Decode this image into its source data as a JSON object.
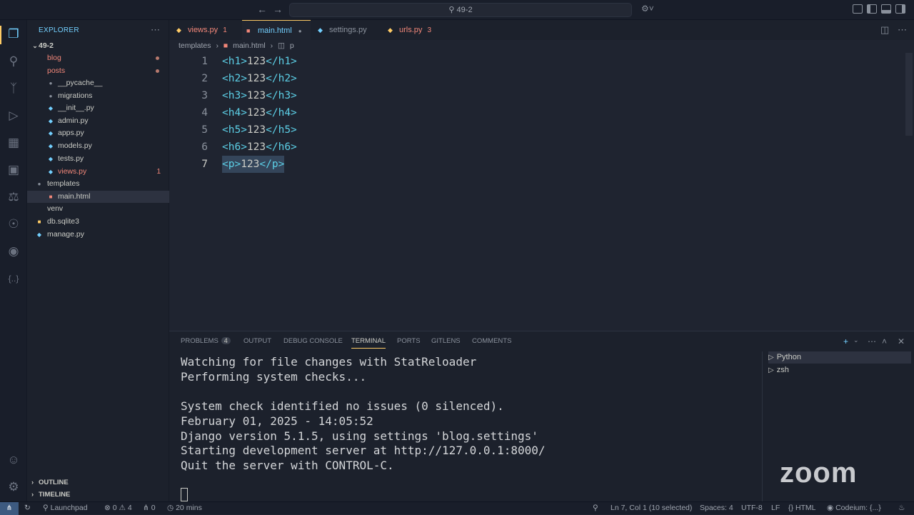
{
  "window": {
    "title": "49-2"
  },
  "colors": {
    "accent": "#ffcc66",
    "link": "#73d0ff",
    "tag": "#5ccfe6",
    "error": "#f28779"
  },
  "explorer": {
    "title": "EXPLORER",
    "more_icon": "ellipsis-icon",
    "root": "49-2",
    "items": [
      {
        "label": "blog",
        "kind": "folder",
        "depth": 1,
        "status": "dot"
      },
      {
        "label": "posts",
        "kind": "folder",
        "depth": 1,
        "status": "dot"
      },
      {
        "label": "__pycache__",
        "kind": "folder",
        "depth": 2
      },
      {
        "label": "migrations",
        "kind": "folder",
        "depth": 2
      },
      {
        "label": "__init__.py",
        "kind": "python",
        "depth": 2
      },
      {
        "label": "admin.py",
        "kind": "python",
        "depth": 2
      },
      {
        "label": "apps.py",
        "kind": "python",
        "depth": 2
      },
      {
        "label": "models.py",
        "kind": "python",
        "depth": 2
      },
      {
        "label": "tests.py",
        "kind": "python",
        "depth": 2
      },
      {
        "label": "views.py",
        "kind": "python",
        "depth": 2,
        "count": "1"
      },
      {
        "label": "templates",
        "kind": "folder",
        "depth": 1
      },
      {
        "label": "main.html",
        "kind": "html",
        "depth": 2,
        "selected": true
      },
      {
        "label": "venv",
        "kind": "folder",
        "depth": 1
      },
      {
        "label": "db.sqlite3",
        "kind": "db",
        "depth": 1
      },
      {
        "label": "manage.py",
        "kind": "python",
        "depth": 1
      }
    ],
    "outline": "OUTLINE",
    "timeline": "TIMELINE"
  },
  "tabs": [
    {
      "label": "views.py",
      "badge": "1",
      "icon": "python-icon"
    },
    {
      "label": "main.html",
      "badge": "●",
      "icon": "html-icon",
      "active": true
    },
    {
      "label": "settings.py",
      "badge": "",
      "icon": "python-icon"
    },
    {
      "label": "urls.py",
      "badge": "3",
      "icon": "python-icon"
    }
  ],
  "breadcrumb": [
    "templates",
    "main.html",
    "p"
  ],
  "code": [
    {
      "n": "1",
      "open": "<h1>",
      "text": "123",
      "close": "</h1>"
    },
    {
      "n": "2",
      "open": "<h2>",
      "text": "123",
      "close": "</h2>"
    },
    {
      "n": "3",
      "open": "<h3>",
      "text": "123",
      "close": "</h3>"
    },
    {
      "n": "4",
      "open": "<h4>",
      "text": "123",
      "close": "</h4>"
    },
    {
      "n": "5",
      "open": "<h5>",
      "text": "123",
      "close": "</h5>"
    },
    {
      "n": "6",
      "open": "<h6>",
      "text": "123",
      "close": "</h6>"
    },
    {
      "n": "7",
      "open": "<p>",
      "text": "123",
      "close": "</p>",
      "selected": true
    }
  ],
  "panel": {
    "tabs": [
      {
        "label": "PROBLEMS",
        "badge": "4"
      },
      {
        "label": "OUTPUT"
      },
      {
        "label": "DEBUG CONSOLE"
      },
      {
        "label": "TERMINAL",
        "active": true
      },
      {
        "label": "PORTS"
      },
      {
        "label": "GITLENS"
      },
      {
        "label": "COMMENTS"
      }
    ],
    "terminal_lines": [
      "Watching for file changes with StatReloader",
      "Performing system checks...",
      "",
      "System check identified no issues (0 silenced).",
      "February 01, 2025 - 14:05:52",
      "Django version 5.1.5, using settings 'blog.settings'",
      "Starting development server at http://127.0.0.1:8000/",
      "Quit the server with CONTROL-C."
    ],
    "terminals": [
      {
        "label": "Python",
        "active": true
      },
      {
        "label": "zsh"
      }
    ]
  },
  "watermark": "zoom",
  "status": {
    "launchpad": "Launchpad",
    "errors": "0",
    "warnings": "4",
    "ports": "0",
    "time": "20 mins",
    "position": "Ln 7, Col 1 (10 selected)",
    "spaces": "Spaces: 4",
    "encoding": "UTF-8",
    "eol": "LF",
    "language": "HTML",
    "codeium": "Codeium: {...}"
  }
}
